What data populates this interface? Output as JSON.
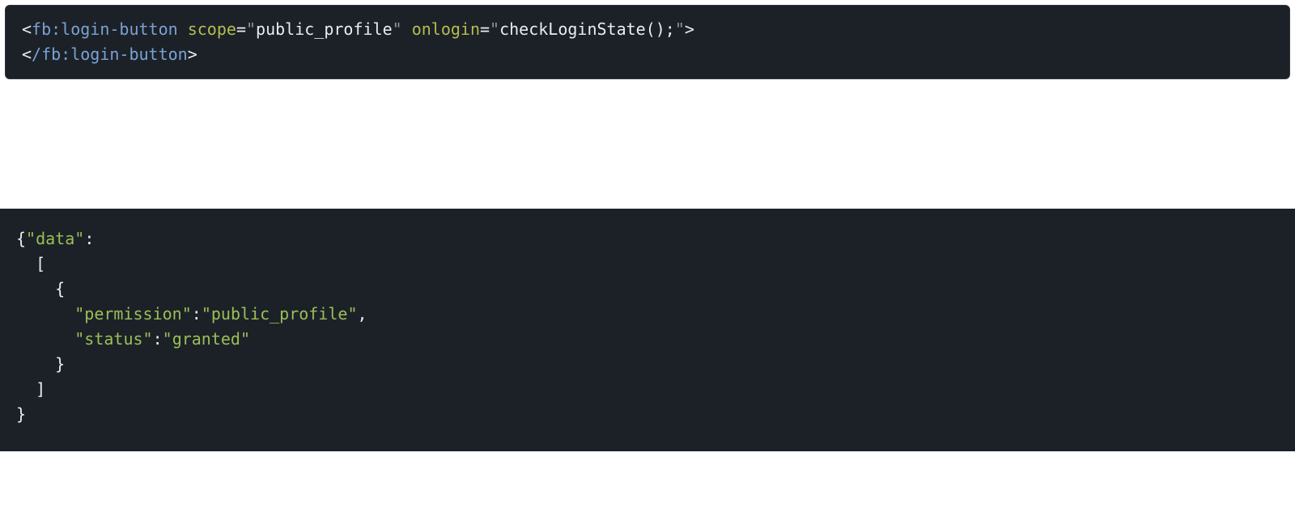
{
  "code1": {
    "line1": {
      "open_lt": "<",
      "tag_open": "fb:login-button",
      "space1": " ",
      "attr1_name": "scope",
      "eq1": "=",
      "q1a": "\"",
      "attr1_val": "public_profile",
      "q1b": "\"",
      "space2": " ",
      "attr2_name": "onlogin",
      "eq2": "=",
      "q2a": "\"",
      "attr2_val": "checkLoginState();",
      "q2b": "\"",
      "close_gt": ">"
    },
    "line2": {
      "open_lt": "<",
      "slash": "/",
      "tag_close": "fb:login-button",
      "close_gt": ">"
    }
  },
  "code2": {
    "l1_brace": "{",
    "l1_q1": "\"",
    "l1_key": "data",
    "l1_q2": "\"",
    "l1_colon": ":",
    "l2_indent": "  ",
    "l2_bracket": "[",
    "l3_indent": "    ",
    "l3_brace": "{",
    "l4_indent": "      ",
    "l4_q1": "\"",
    "l4_key": "permission",
    "l4_q2": "\"",
    "l4_colon": ":",
    "l4_q3": "\"",
    "l4_val": "public_profile",
    "l4_q4": "\"",
    "l4_comma": ",",
    "l5_indent": "      ",
    "l5_q1": "\"",
    "l5_key": "status",
    "l5_q2": "\"",
    "l5_colon": ":",
    "l5_q3": "\"",
    "l5_val": "granted",
    "l5_q4": "\"",
    "l6_indent": "    ",
    "l6_brace": "}",
    "l7_indent": "  ",
    "l7_bracket": "]",
    "l8_brace": "}"
  }
}
